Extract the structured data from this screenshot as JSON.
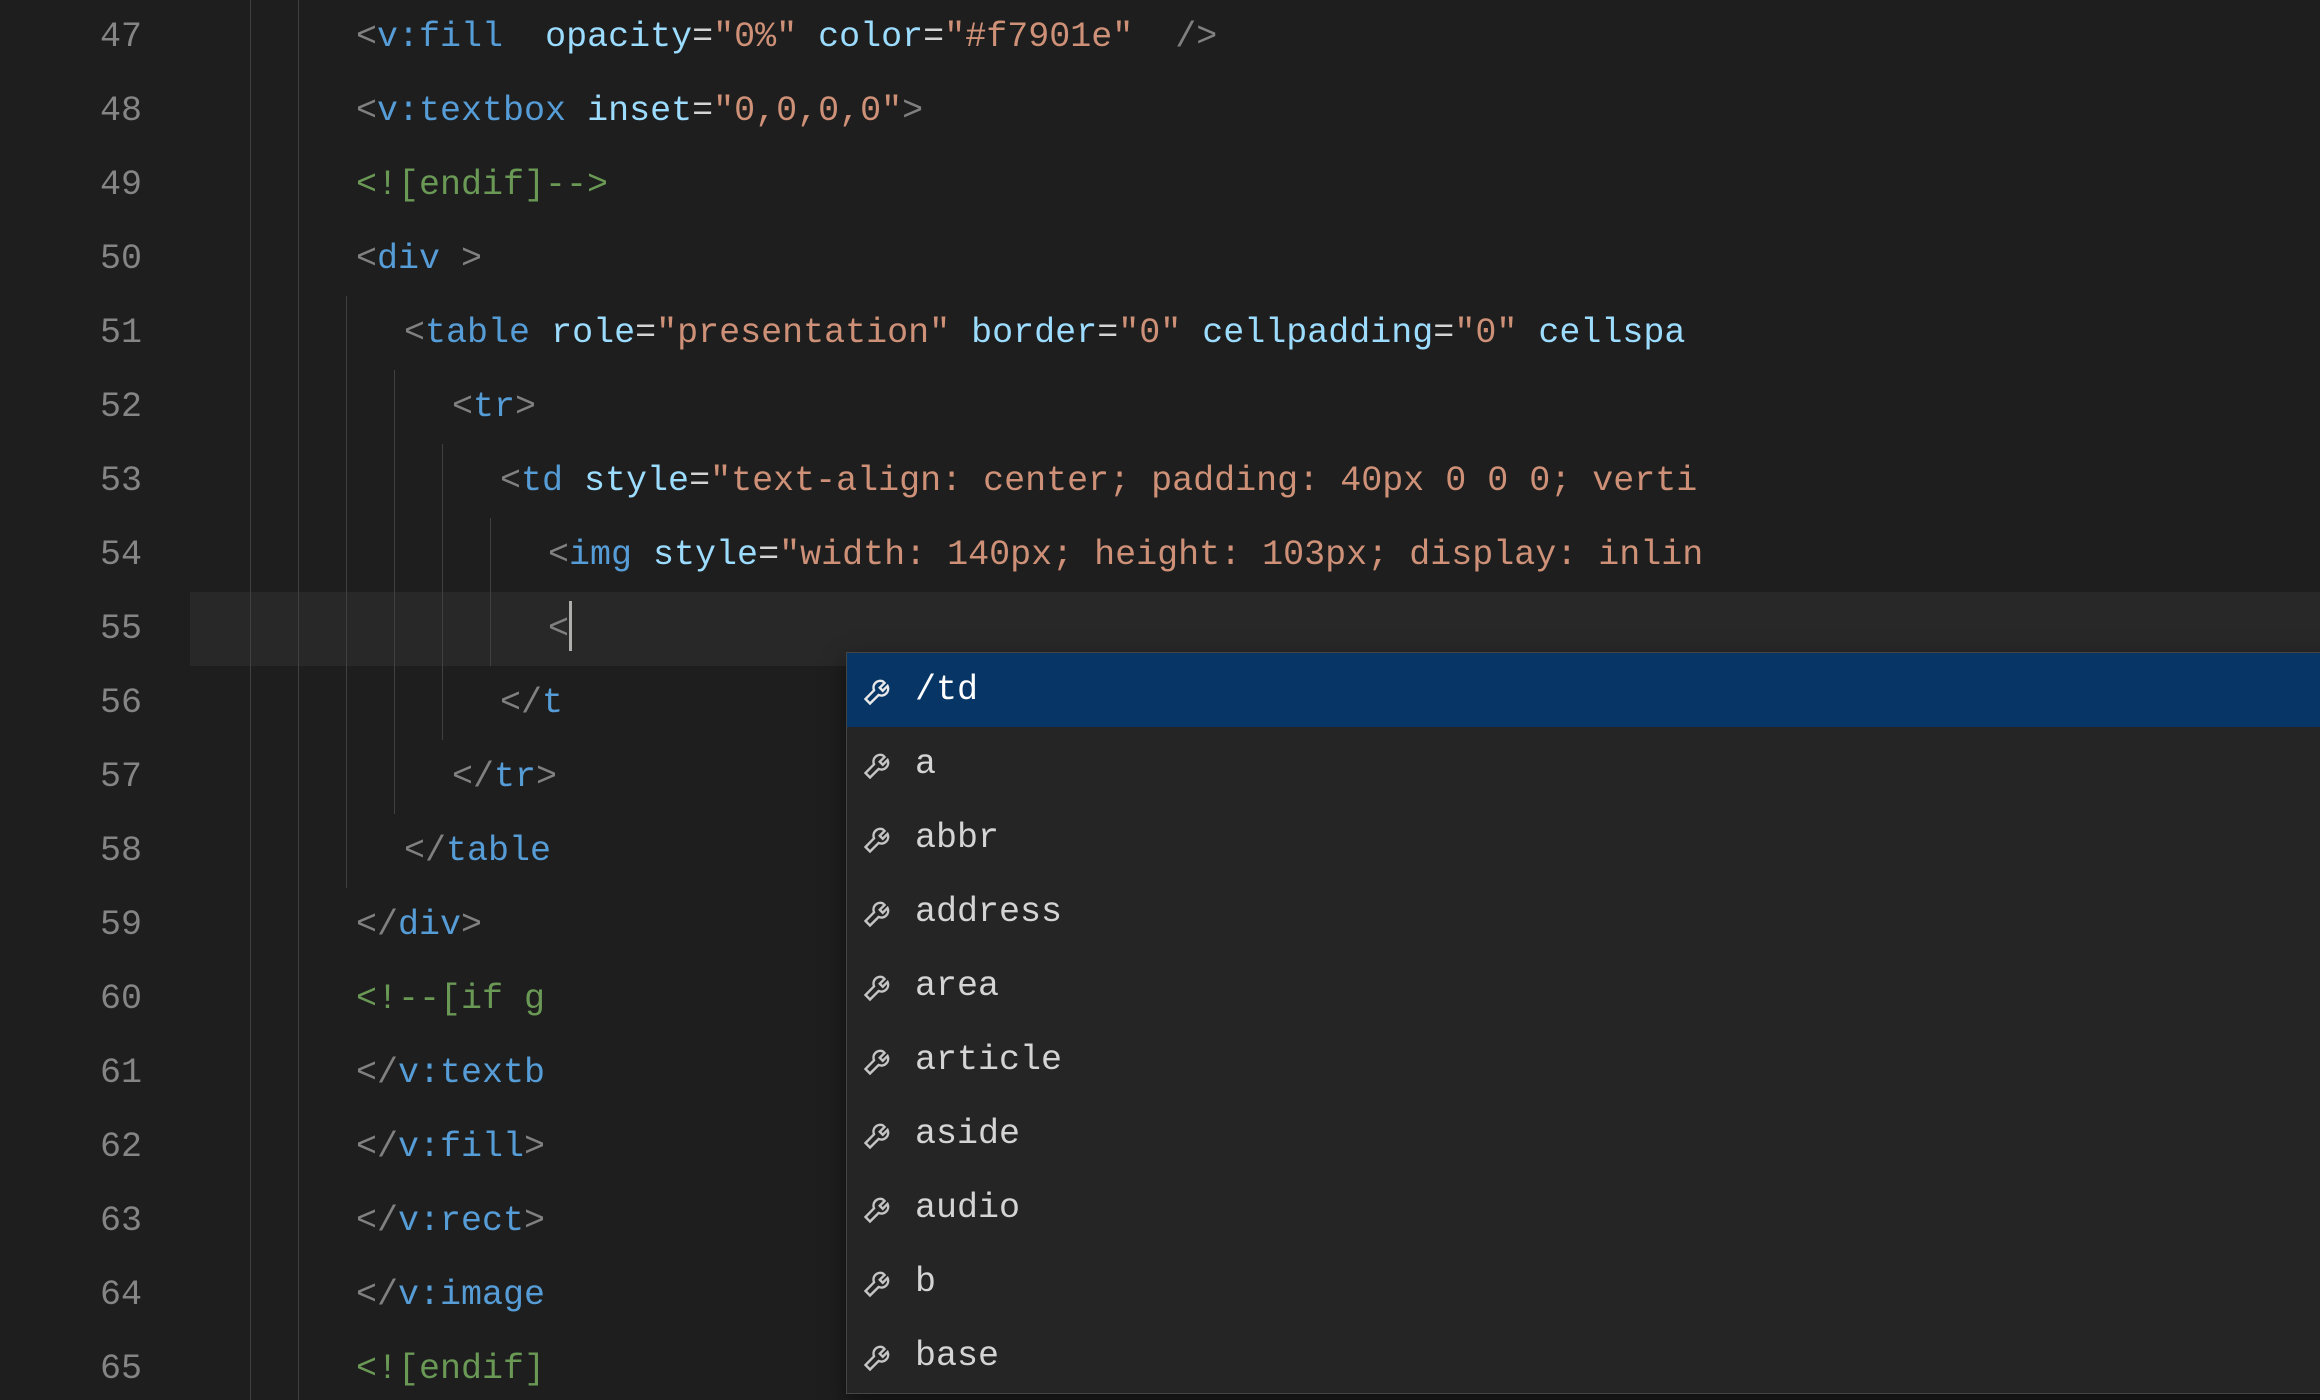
{
  "gutter": {
    "start": 47,
    "end": 65
  },
  "code": {
    "l47": {
      "segs": [
        {
          "cls": "t-bracket",
          "txt": "<"
        },
        {
          "cls": "t-tag",
          "txt": "v:fill"
        },
        {
          "cls": "t-plain",
          "txt": "  "
        },
        {
          "cls": "t-attr",
          "txt": "opacity"
        },
        {
          "cls": "t-punc",
          "txt": "="
        },
        {
          "cls": "t-str",
          "txt": "\"0%\""
        },
        {
          "cls": "t-plain",
          "txt": " "
        },
        {
          "cls": "t-attr",
          "txt": "color"
        },
        {
          "cls": "t-punc",
          "txt": "="
        },
        {
          "cls": "t-str",
          "txt": "\"#f7901e\""
        },
        {
          "cls": "t-plain",
          "txt": "  "
        },
        {
          "cls": "t-bracket",
          "txt": "/>"
        }
      ],
      "indent": 2
    },
    "l48": {
      "segs": [
        {
          "cls": "t-bracket",
          "txt": "<"
        },
        {
          "cls": "t-tag",
          "txt": "v:textbox"
        },
        {
          "cls": "t-plain",
          "txt": " "
        },
        {
          "cls": "t-attr",
          "txt": "inset"
        },
        {
          "cls": "t-punc",
          "txt": "="
        },
        {
          "cls": "t-str",
          "txt": "\"0,0,0,0\""
        },
        {
          "cls": "t-bracket",
          "txt": ">"
        }
      ],
      "indent": 2
    },
    "l49": {
      "segs": [
        {
          "cls": "t-comment",
          "txt": "<![endif]-->"
        }
      ],
      "indent": 2
    },
    "l50": {
      "segs": [
        {
          "cls": "t-bracket",
          "txt": "<"
        },
        {
          "cls": "t-tag",
          "txt": "div"
        },
        {
          "cls": "t-plain",
          "txt": " "
        },
        {
          "cls": "t-bracket",
          "txt": ">"
        }
      ],
      "indent": 2
    },
    "l51": {
      "segs": [
        {
          "cls": "t-bracket",
          "txt": "<"
        },
        {
          "cls": "t-tag",
          "txt": "table"
        },
        {
          "cls": "t-plain",
          "txt": " "
        },
        {
          "cls": "t-attr",
          "txt": "role"
        },
        {
          "cls": "t-punc",
          "txt": "="
        },
        {
          "cls": "t-str",
          "txt": "\"presentation\""
        },
        {
          "cls": "t-plain",
          "txt": " "
        },
        {
          "cls": "t-attr",
          "txt": "border"
        },
        {
          "cls": "t-punc",
          "txt": "="
        },
        {
          "cls": "t-str",
          "txt": "\"0\""
        },
        {
          "cls": "t-plain",
          "txt": " "
        },
        {
          "cls": "t-attr",
          "txt": "cellpadding"
        },
        {
          "cls": "t-punc",
          "txt": "="
        },
        {
          "cls": "t-str",
          "txt": "\"0\""
        },
        {
          "cls": "t-plain",
          "txt": " "
        },
        {
          "cls": "t-attr",
          "txt": "cellspa"
        }
      ],
      "indent": 3
    },
    "l52": {
      "segs": [
        {
          "cls": "t-bracket",
          "txt": "<"
        },
        {
          "cls": "t-tag",
          "txt": "tr"
        },
        {
          "cls": "t-bracket",
          "txt": ">"
        }
      ],
      "indent": 4
    },
    "l53": {
      "segs": [
        {
          "cls": "t-bracket",
          "txt": "<"
        },
        {
          "cls": "t-tag",
          "txt": "td"
        },
        {
          "cls": "t-plain",
          "txt": " "
        },
        {
          "cls": "t-attr",
          "txt": "style"
        },
        {
          "cls": "t-punc",
          "txt": "="
        },
        {
          "cls": "t-str",
          "txt": "\"text-align: center; padding: 40px 0 0 0; verti"
        }
      ],
      "indent": 5
    },
    "l54": {
      "segs": [
        {
          "cls": "t-bracket",
          "txt": "<"
        },
        {
          "cls": "t-tag",
          "txt": "img"
        },
        {
          "cls": "t-plain",
          "txt": " "
        },
        {
          "cls": "t-attr",
          "txt": "style"
        },
        {
          "cls": "t-punc",
          "txt": "="
        },
        {
          "cls": "t-str",
          "txt": "\"width: 140px; height: 103px; display: inlin"
        }
      ],
      "indent": 6
    },
    "l55": {
      "segs": [
        {
          "cls": "t-bracket",
          "txt": "<"
        }
      ],
      "indent": 6,
      "cursor": true,
      "current": true
    },
    "l56": {
      "segs": [
        {
          "cls": "t-bracket",
          "txt": "</"
        },
        {
          "cls": "t-tag",
          "txt": "t"
        }
      ],
      "indent": 5
    },
    "l57": {
      "segs": [
        {
          "cls": "t-bracket",
          "txt": "</"
        },
        {
          "cls": "t-tag",
          "txt": "tr"
        },
        {
          "cls": "t-bracket",
          "txt": ">"
        }
      ],
      "indent": 4
    },
    "l58": {
      "segs": [
        {
          "cls": "t-bracket",
          "txt": "</"
        },
        {
          "cls": "t-tag",
          "txt": "table"
        }
      ],
      "indent": 3
    },
    "l59": {
      "segs": [
        {
          "cls": "t-bracket",
          "txt": "</"
        },
        {
          "cls": "t-tag",
          "txt": "div"
        },
        {
          "cls": "t-bracket",
          "txt": ">"
        }
      ],
      "indent": 2
    },
    "l60": {
      "segs": [
        {
          "cls": "t-comment",
          "txt": "<!--[if g"
        }
      ],
      "indent": 2
    },
    "l61": {
      "segs": [
        {
          "cls": "t-bracket",
          "txt": "</"
        },
        {
          "cls": "t-tag",
          "txt": "v:textb"
        }
      ],
      "indent": 2
    },
    "l62": {
      "segs": [
        {
          "cls": "t-bracket",
          "txt": "</"
        },
        {
          "cls": "t-tag",
          "txt": "v:fill"
        },
        {
          "cls": "t-bracket",
          "txt": ">"
        }
      ],
      "indent": 2
    },
    "l63": {
      "segs": [
        {
          "cls": "t-bracket",
          "txt": "</"
        },
        {
          "cls": "t-tag",
          "txt": "v:rect"
        },
        {
          "cls": "t-bracket",
          "txt": ">"
        }
      ],
      "indent": 2
    },
    "l64": {
      "segs": [
        {
          "cls": "t-bracket",
          "txt": "</"
        },
        {
          "cls": "t-tag",
          "txt": "v:image"
        }
      ],
      "indent": 2
    },
    "l65": {
      "segs": [
        {
          "cls": "t-comment",
          "txt": "<![endif]"
        }
      ],
      "indent": 2
    }
  },
  "suggestions": [
    {
      "label": "/td",
      "selected": true
    },
    {
      "label": "a",
      "selected": false
    },
    {
      "label": "abbr",
      "selected": false
    },
    {
      "label": "address",
      "selected": false
    },
    {
      "label": "area",
      "selected": false
    },
    {
      "label": "article",
      "selected": false
    },
    {
      "label": "aside",
      "selected": false
    },
    {
      "label": "audio",
      "selected": false
    },
    {
      "label": "b",
      "selected": false
    },
    {
      "label": "base",
      "selected": false
    }
  ],
  "layout": {
    "indentUnitPx": 48,
    "baseIndentPx": 60,
    "guideLevels": [
      1,
      2,
      3,
      4,
      5,
      6
    ]
  }
}
